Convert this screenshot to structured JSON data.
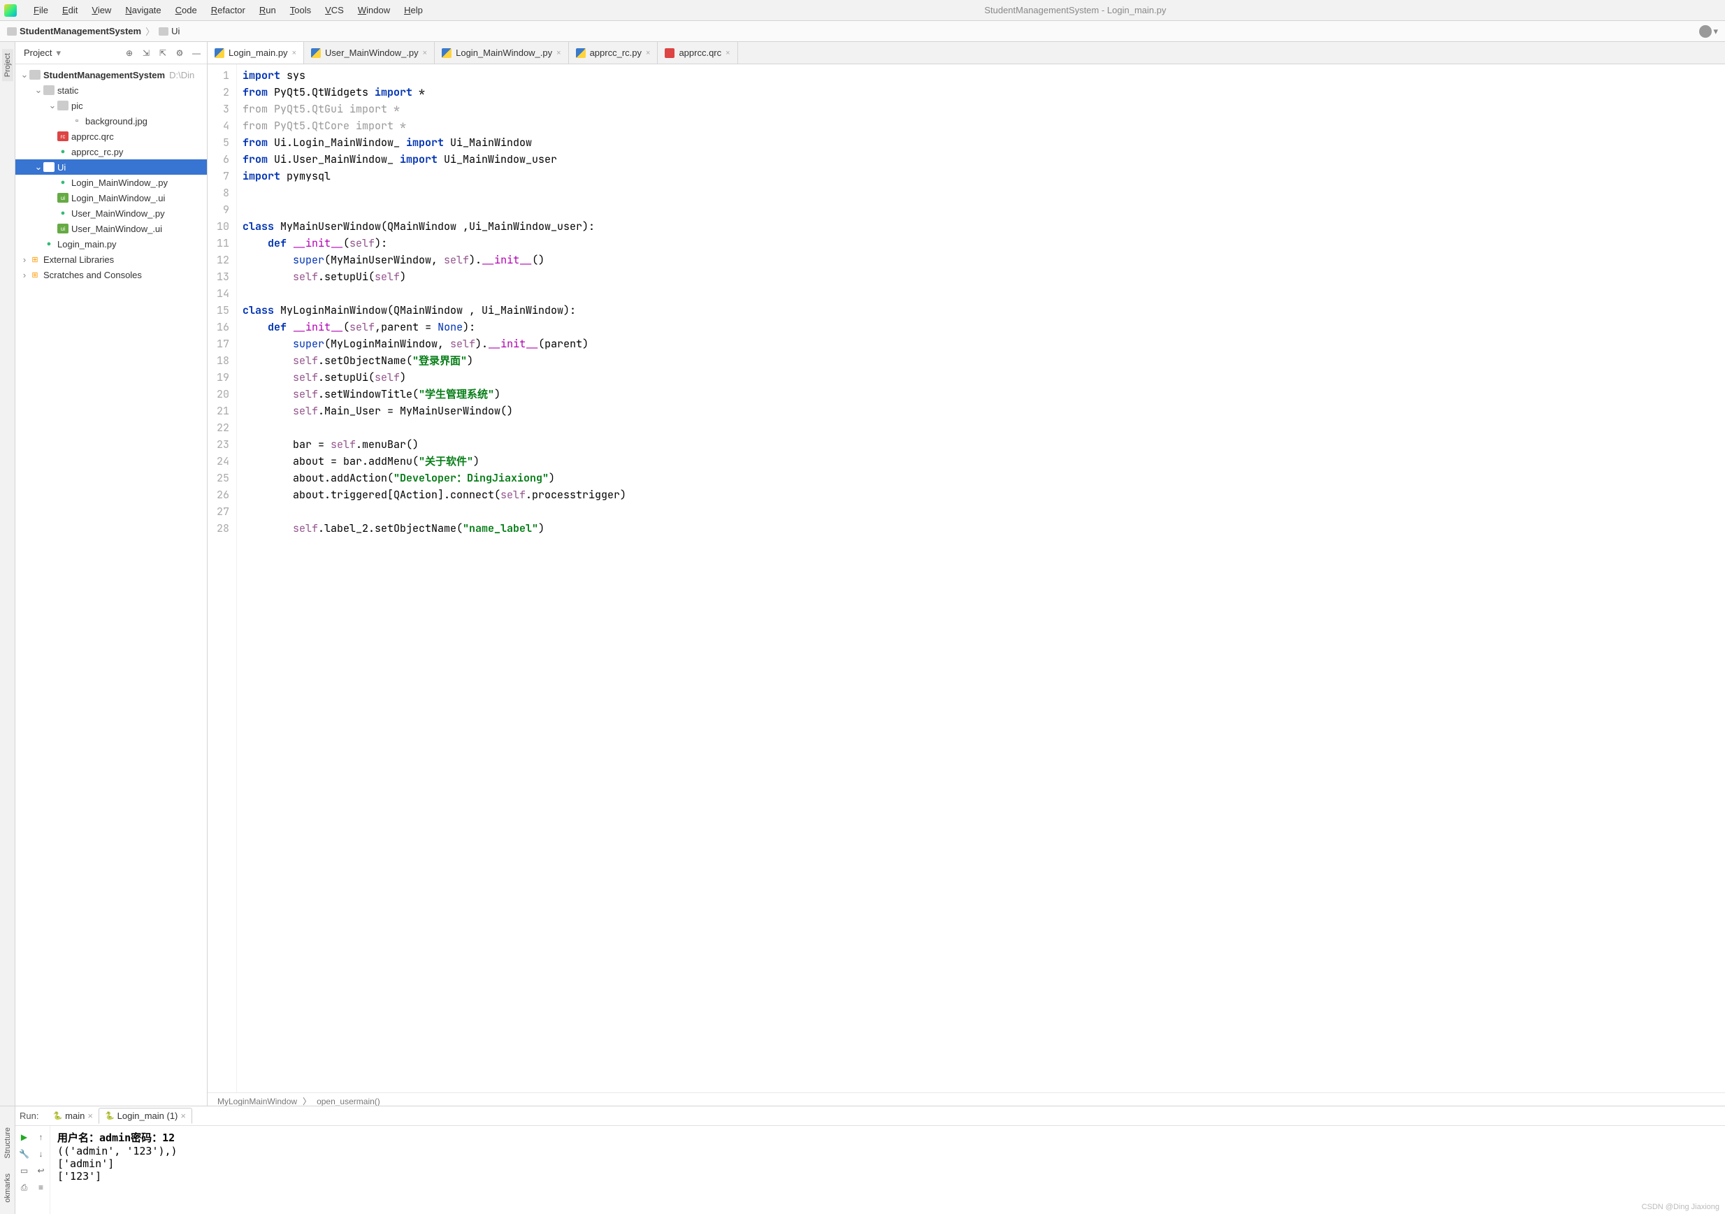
{
  "window_title": "StudentManagementSystem - Login_main.py",
  "menu": [
    "File",
    "Edit",
    "View",
    "Navigate",
    "Code",
    "Refactor",
    "Run",
    "Tools",
    "VCS",
    "Window",
    "Help"
  ],
  "breadcrumb": {
    "root": "StudentManagementSystem",
    "leaf": "Ui"
  },
  "leftstrip": {
    "project": "Project",
    "structure": "Structure",
    "bookmarks": "okmarks"
  },
  "project_panel": {
    "header_title": "Project",
    "toolbar_icons": [
      "target",
      "collapse",
      "expand",
      "settings",
      "minimize"
    ],
    "tree": [
      {
        "depth": 0,
        "expander": "v",
        "icon": "folder",
        "label": "StudentManagementSystem",
        "dim": "D:\\Din"
      },
      {
        "depth": 1,
        "expander": "v",
        "icon": "folder",
        "label": "static"
      },
      {
        "depth": 2,
        "expander": "v",
        "icon": "folder",
        "label": "pic"
      },
      {
        "depth": 3,
        "expander": "",
        "icon": "file",
        "label": "background.jpg"
      },
      {
        "depth": 2,
        "expander": "",
        "icon": "qrc",
        "label": "apprcc.qrc"
      },
      {
        "depth": 2,
        "expander": "",
        "icon": "py",
        "label": "apprcc_rc.py"
      },
      {
        "depth": 1,
        "expander": "v",
        "icon": "folder",
        "label": "Ui",
        "selected": true
      },
      {
        "depth": 2,
        "expander": "",
        "icon": "py",
        "label": "Login_MainWindow_.py"
      },
      {
        "depth": 2,
        "expander": "",
        "icon": "ui",
        "label": "Login_MainWindow_.ui"
      },
      {
        "depth": 2,
        "expander": "",
        "icon": "py",
        "label": "User_MainWindow_.py"
      },
      {
        "depth": 2,
        "expander": "",
        "icon": "ui",
        "label": "User_MainWindow_.ui"
      },
      {
        "depth": 1,
        "expander": "",
        "icon": "py",
        "label": "Login_main.py"
      },
      {
        "depth": 0,
        "expander": ">",
        "icon": "lib",
        "label": "External Libraries"
      },
      {
        "depth": 0,
        "expander": ">",
        "icon": "lib",
        "label": "Scratches and Consoles"
      }
    ]
  },
  "editor_tabs": [
    {
      "icon": "py",
      "label": "Login_main.py",
      "active": true
    },
    {
      "icon": "py",
      "label": "User_MainWindow_.py"
    },
    {
      "icon": "py",
      "label": "Login_MainWindow_.py"
    },
    {
      "icon": "py",
      "label": "apprcc_rc.py"
    },
    {
      "icon": "qrc",
      "label": "apprcc.qrc"
    }
  ],
  "code_lines": [
    [
      {
        "t": "import ",
        "c": "kw"
      },
      {
        "t": "sys",
        "c": "normal"
      }
    ],
    [
      {
        "t": "from ",
        "c": "kw"
      },
      {
        "t": "PyQt5.QtWidgets ",
        "c": "normal"
      },
      {
        "t": "import ",
        "c": "kw"
      },
      {
        "t": "*",
        "c": "normal"
      }
    ],
    [
      {
        "t": "from PyQt5.QtGui import *",
        "c": "dim-code"
      }
    ],
    [
      {
        "t": "from PyQt5.QtCore import *",
        "c": "dim-code"
      }
    ],
    [
      {
        "t": "from ",
        "c": "kw"
      },
      {
        "t": "Ui.Login_MainWindow_ ",
        "c": "normal"
      },
      {
        "t": "import ",
        "c": "kw"
      },
      {
        "t": "Ui_MainWindow",
        "c": "normal"
      }
    ],
    [
      {
        "t": "from ",
        "c": "kw"
      },
      {
        "t": "Ui.User_MainWindow_ ",
        "c": "normal"
      },
      {
        "t": "import ",
        "c": "kw"
      },
      {
        "t": "Ui_MainWindow_user",
        "c": "normal"
      }
    ],
    [
      {
        "t": "import ",
        "c": "kw"
      },
      {
        "t": "pymysql",
        "c": "normal"
      }
    ],
    [],
    [],
    [
      {
        "t": "class ",
        "c": "kw"
      },
      {
        "t": "MyMainUserWindow",
        "c": "normal"
      },
      {
        "t": "(QMainWindow ,Ui_MainWindow_user):",
        "c": "normal"
      }
    ],
    [
      {
        "t": "    def ",
        "c": "kw"
      },
      {
        "t": "__init__",
        "c": "def"
      },
      {
        "t": "(",
        "c": "normal"
      },
      {
        "t": "self",
        "c": "self"
      },
      {
        "t": "):",
        "c": "normal"
      }
    ],
    [
      {
        "t": "        super",
        "c": "kw2"
      },
      {
        "t": "(MyMainUserWindow, ",
        "c": "normal"
      },
      {
        "t": "self",
        "c": "self"
      },
      {
        "t": ").",
        "c": "normal"
      },
      {
        "t": "__init__",
        "c": "def"
      },
      {
        "t": "()",
        "c": "normal"
      }
    ],
    [
      {
        "t": "        ",
        "c": "normal"
      },
      {
        "t": "self",
        "c": "self"
      },
      {
        "t": ".setupUi(",
        "c": "normal"
      },
      {
        "t": "self",
        "c": "self"
      },
      {
        "t": ")",
        "c": "normal"
      }
    ],
    [],
    [
      {
        "t": "class ",
        "c": "kw"
      },
      {
        "t": "MyLoginMainWindow",
        "c": "normal"
      },
      {
        "t": "(QMainWindow , Ui_MainWindow):",
        "c": "normal"
      }
    ],
    [
      {
        "t": "    def ",
        "c": "kw"
      },
      {
        "t": "__init__",
        "c": "def"
      },
      {
        "t": "(",
        "c": "normal"
      },
      {
        "t": "self",
        "c": "self"
      },
      {
        "t": ",parent = ",
        "c": "normal"
      },
      {
        "t": "None",
        "c": "kw2"
      },
      {
        "t": "):",
        "c": "normal"
      }
    ],
    [
      {
        "t": "        super",
        "c": "kw2"
      },
      {
        "t": "(MyLoginMainWindow, ",
        "c": "normal"
      },
      {
        "t": "self",
        "c": "self"
      },
      {
        "t": ").",
        "c": "normal"
      },
      {
        "t": "__init__",
        "c": "def"
      },
      {
        "t": "(parent)",
        "c": "normal"
      }
    ],
    [
      {
        "t": "        ",
        "c": "normal"
      },
      {
        "t": "self",
        "c": "self"
      },
      {
        "t": ".setObjectName(",
        "c": "normal"
      },
      {
        "t": "\"登录界面\"",
        "c": "str"
      },
      {
        "t": ")",
        "c": "normal"
      }
    ],
    [
      {
        "t": "        ",
        "c": "normal"
      },
      {
        "t": "self",
        "c": "self"
      },
      {
        "t": ".setupUi(",
        "c": "normal"
      },
      {
        "t": "self",
        "c": "self"
      },
      {
        "t": ")",
        "c": "normal"
      }
    ],
    [
      {
        "t": "        ",
        "c": "normal"
      },
      {
        "t": "self",
        "c": "self"
      },
      {
        "t": ".setWindowTitle(",
        "c": "normal"
      },
      {
        "t": "\"学生管理系统\"",
        "c": "str"
      },
      {
        "t": ")",
        "c": "normal"
      }
    ],
    [
      {
        "t": "        ",
        "c": "normal"
      },
      {
        "t": "self",
        "c": "self"
      },
      {
        "t": ".Main_User = MyMainUserWindow()",
        "c": "normal"
      }
    ],
    [],
    [
      {
        "t": "        bar = ",
        "c": "normal"
      },
      {
        "t": "self",
        "c": "self"
      },
      {
        "t": ".menuBar()",
        "c": "normal"
      }
    ],
    [
      {
        "t": "        about = bar.addMenu(",
        "c": "normal"
      },
      {
        "t": "\"关于软件\"",
        "c": "str"
      },
      {
        "t": ")",
        "c": "normal"
      }
    ],
    [
      {
        "t": "        about.addAction(",
        "c": "normal"
      },
      {
        "t": "\"Developer：DingJiaxiong\"",
        "c": "str"
      },
      {
        "t": ")",
        "c": "normal"
      }
    ],
    [
      {
        "t": "        about.triggered[QAction].connect(",
        "c": "normal"
      },
      {
        "t": "self",
        "c": "self"
      },
      {
        "t": ".processtrigger)",
        "c": "normal"
      }
    ],
    [],
    [
      {
        "t": "        ",
        "c": "normal"
      },
      {
        "t": "self",
        "c": "self"
      },
      {
        "t": ".label_2.setObjectName(",
        "c": "normal"
      },
      {
        "t": "\"name_label\"",
        "c": "str"
      },
      {
        "t": ")",
        "c": "normal"
      }
    ]
  ],
  "editor_crumbs": [
    "MyLoginMainWindow",
    "open_usermain()"
  ],
  "run": {
    "label": "Run:",
    "tabs": [
      {
        "label": "main",
        "active": false
      },
      {
        "label": "Login_main (1)",
        "active": true
      }
    ],
    "output": [
      {
        "text": "用户名：admin密码：12",
        "bold": true
      },
      {
        "text": "(('admin', '123'),)",
        "bold": false
      },
      {
        "text": "['admin']",
        "bold": false
      },
      {
        "text": "['123']",
        "bold": false
      }
    ]
  },
  "watermark": "CSDN @Ding Jiaxiong"
}
